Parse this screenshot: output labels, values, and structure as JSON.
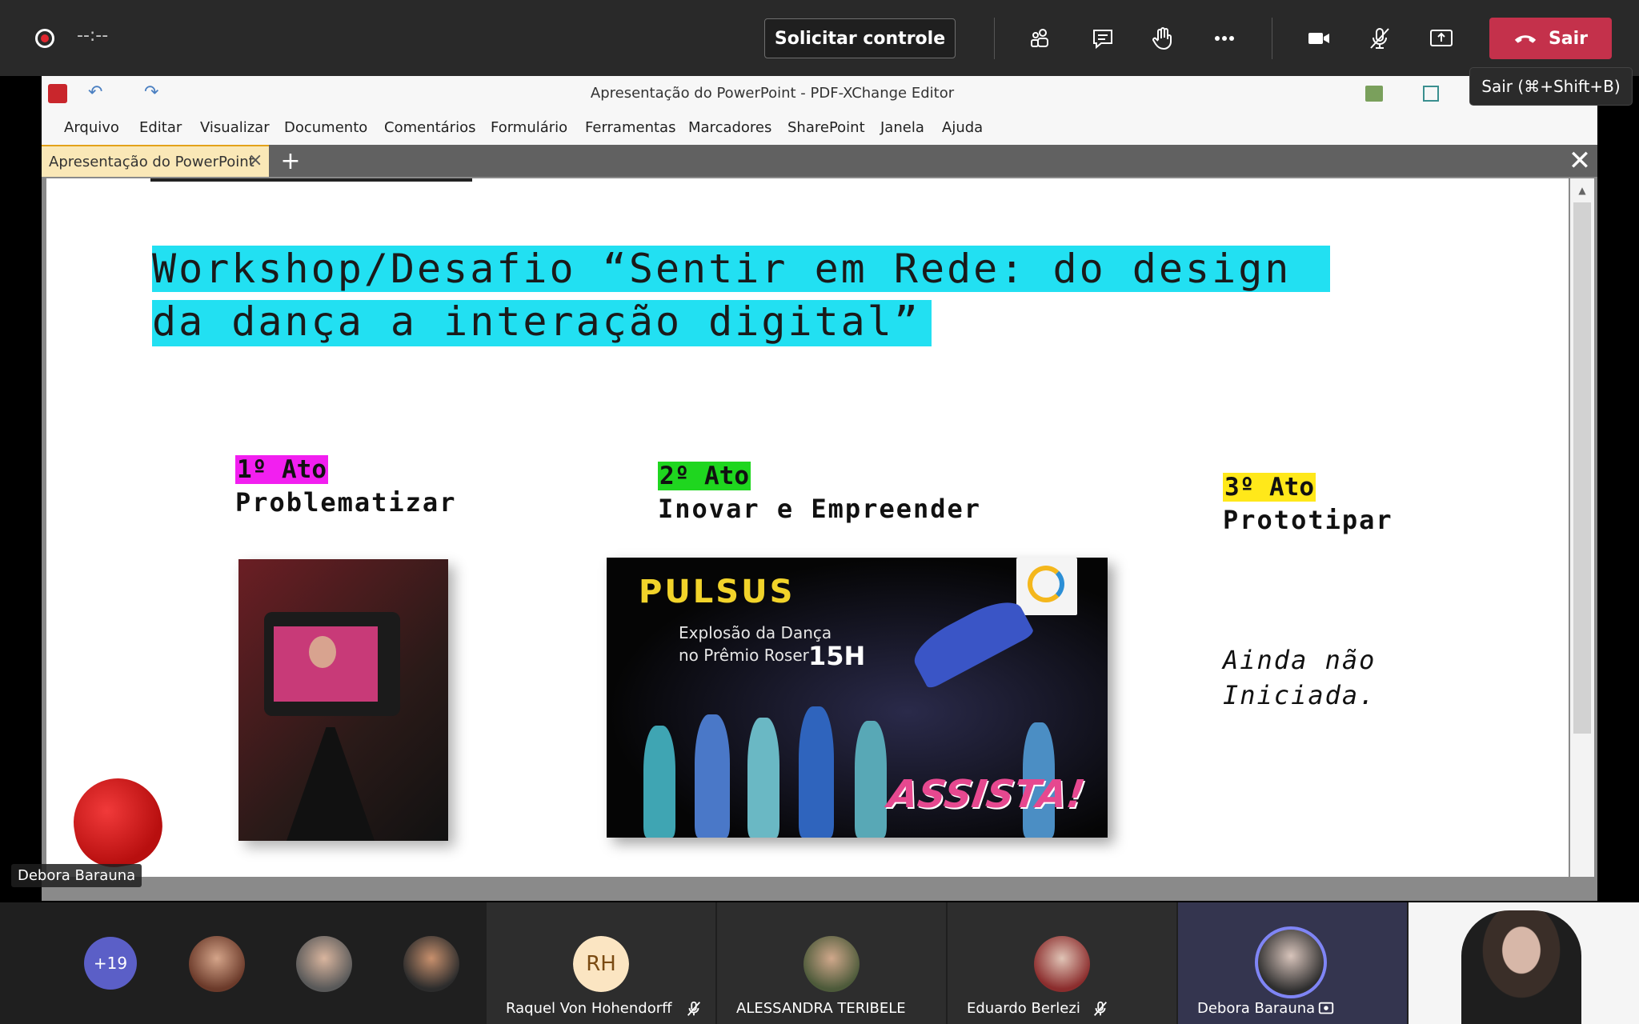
{
  "meeting": {
    "timer": "--:--",
    "request_control_label": "Solicitar controle",
    "leave_label": "Sair",
    "leave_tooltip": "Sair (⌘+Shift+B)",
    "icons": [
      "participants-icon",
      "chat-icon",
      "raise-hand-icon",
      "more-icon",
      "camera-icon",
      "mic-off-icon",
      "share-icon"
    ]
  },
  "editor": {
    "window_title": "Apresentação do PowerPoint - PDF-XChange Editor",
    "menu": [
      "Arquivo",
      "Editar",
      "Visualizar",
      "Documento",
      "Comentários",
      "Formulário",
      "Ferramentas",
      "Marcadores",
      "SharePoint",
      "Janela",
      "Ajuda"
    ],
    "tab_label": "Apresentação do PowerPoint"
  },
  "slide": {
    "title_line1": "Workshop/Desafio “Sentir em Rede: do design",
    "title_line2": "da dança a interação digital”",
    "acts": [
      {
        "tag": "1º Ato",
        "name": "Problematizar",
        "tag_color": "#f21ff0"
      },
      {
        "tag": "2º Ato",
        "name": "Inovar e Empreender",
        "tag_color": "#1fd61f"
      },
      {
        "tag": "3º Ato",
        "name": "Prototipar",
        "tag_color": "#ffe81a"
      }
    ],
    "act3_status_line1": "Ainda não",
    "act3_status_line2": "Iniciada.",
    "poster": {
      "title": "PULSUS",
      "sub1": "Explosão da Dança",
      "sub2": "no Prêmio Roser",
      "time": "15H",
      "cta": "ASSISTA!"
    }
  },
  "presenter_label": "Debora Barauna",
  "participants": {
    "more_count": "+19",
    "named": [
      {
        "name": "Raquel Von Hohendorff",
        "initials": "RH",
        "muted": true
      },
      {
        "name": "ALESSANDRA TERIBELE",
        "muted": false
      },
      {
        "name": "Eduardo Berlezi",
        "muted": true
      },
      {
        "name": "Debora Barauna",
        "muted": false
      }
    ]
  }
}
